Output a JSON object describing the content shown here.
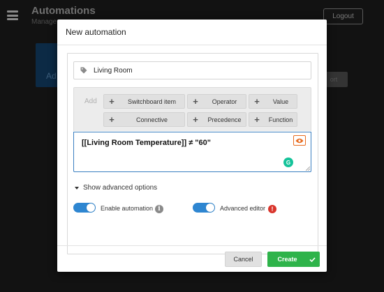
{
  "background": {
    "app_title": "Automations",
    "app_subtitle": "Manage",
    "logout_label": "Logout",
    "card_text": "Ad",
    "button_text": "ort"
  },
  "modal": {
    "title": "New automation",
    "name_value": "Living Room",
    "builder": {
      "add_label": "Add",
      "tokens": [
        {
          "label": "Switchboard item"
        },
        {
          "label": "Operator"
        },
        {
          "label": "Value"
        },
        {
          "label": "Connective"
        },
        {
          "label": "Precedence"
        },
        {
          "label": "Function"
        }
      ]
    },
    "expression": "[[Living Room Temperature]] ≠ \"60\"",
    "grammarly_glyph": "G",
    "advanced_toggle_label": "Show advanced options",
    "enable_automation_label": "Enable automation",
    "enable_automation_on": true,
    "advanced_editor_label": "Advanced editor",
    "advanced_editor_on": true,
    "info_glyph": "i",
    "warning_glyph": "!",
    "cancel_label": "Cancel",
    "create_label": "Create"
  },
  "colors": {
    "accent_blue": "#2e86d1",
    "create_green": "#2eb34a",
    "warning_red": "#d9342b",
    "eye_orange": "#e86b1f"
  },
  "icons": [
    "hamburger-icon",
    "tag-icon",
    "plus-icon",
    "eye-icon",
    "grammarly-icon",
    "caret-down-icon",
    "info-icon",
    "warning-icon",
    "check-icon"
  ]
}
